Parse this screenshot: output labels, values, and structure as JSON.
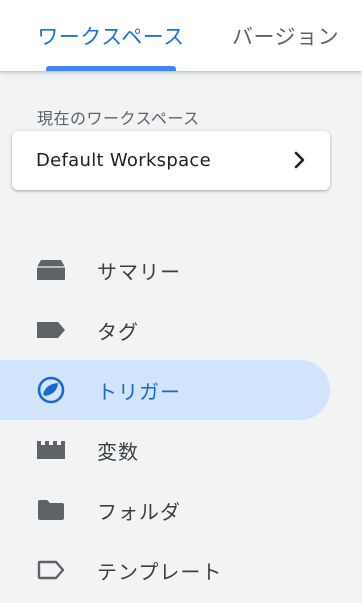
{
  "tabs": {
    "workspace": "ワークスペース",
    "versions": "バージョン"
  },
  "workspace": {
    "label": "現在のワークスペース",
    "name": "Default Workspace"
  },
  "nav": {
    "items": [
      {
        "label": "サマリー",
        "icon": "summary-icon"
      },
      {
        "label": "タグ",
        "icon": "tag-icon"
      },
      {
        "label": "トリガー",
        "icon": "trigger-icon",
        "active": true
      },
      {
        "label": "変数",
        "icon": "variables-icon"
      },
      {
        "label": "フォルダ",
        "icon": "folder-icon"
      },
      {
        "label": "テンプレート",
        "icon": "template-icon"
      }
    ]
  },
  "colors": {
    "accent": "#1a73e8",
    "active_bg": "#d2e3fc",
    "icon": "#5f6368"
  }
}
